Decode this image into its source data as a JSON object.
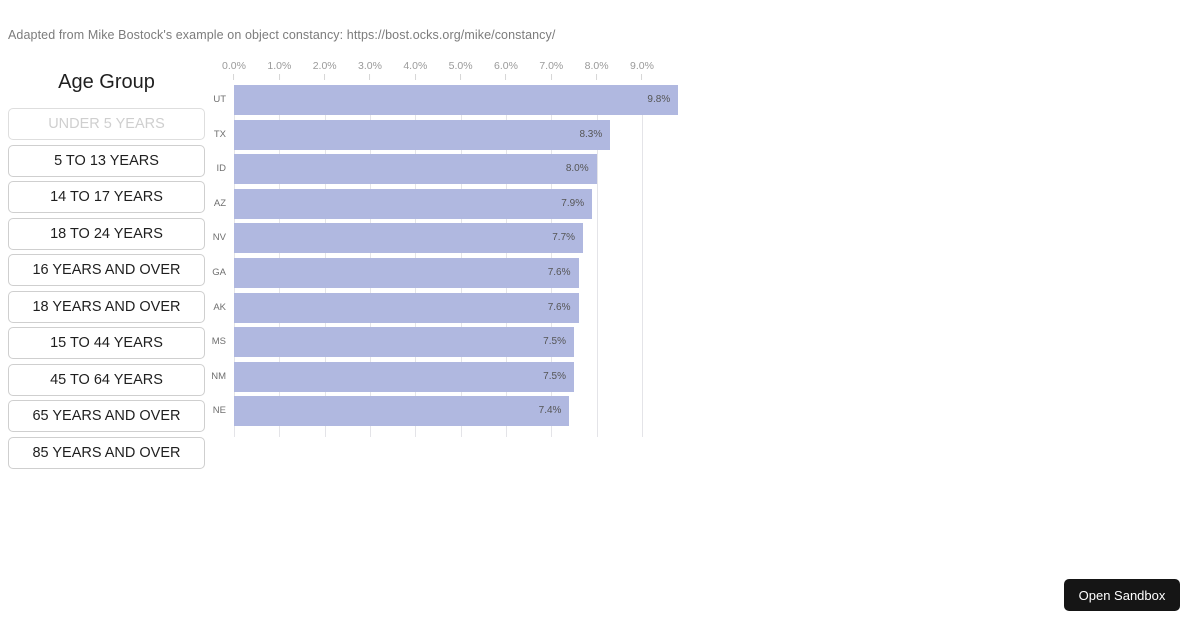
{
  "credit": "Adapted from Mike Bostock's example on object constancy: https://bost.ocks.org/mike/constancy/",
  "sidebar": {
    "title": "Age Group",
    "items": [
      {
        "label": "UNDER 5 YEARS",
        "disabled": true
      },
      {
        "label": "5 TO 13 YEARS",
        "disabled": false
      },
      {
        "label": "14 TO 17 YEARS",
        "disabled": false
      },
      {
        "label": "18 TO 24 YEARS",
        "disabled": false
      },
      {
        "label": "16 YEARS AND OVER",
        "disabled": false
      },
      {
        "label": "18 YEARS AND OVER",
        "disabled": false
      },
      {
        "label": "15 TO 44 YEARS",
        "disabled": false
      },
      {
        "label": "45 TO 64 YEARS",
        "disabled": false
      },
      {
        "label": "65 YEARS AND OVER",
        "disabled": false
      },
      {
        "label": "85 YEARS AND OVER",
        "disabled": false
      }
    ]
  },
  "footer": {
    "open_sandbox_label": "Open Sandbox"
  },
  "colors": {
    "bar_fill": "#b0b8e0",
    "gridline": "#e4e4e8",
    "tick_label": "#9a9a9a",
    "bar_label": "#6f6f6f",
    "value_label": "#555555",
    "sandbox_button_bg": "#151515"
  },
  "chart_data": {
    "type": "bar",
    "orientation": "horizontal",
    "title": "",
    "subtitle": "",
    "xlabel": "",
    "ylabel": "",
    "categories": [
      "UT",
      "TX",
      "ID",
      "AZ",
      "NV",
      "GA",
      "AK",
      "MS",
      "NM",
      "NE"
    ],
    "values": [
      9.8,
      8.3,
      8.0,
      7.9,
      7.7,
      7.6,
      7.6,
      7.5,
      7.5,
      7.4
    ],
    "value_labels": [
      "9.8%",
      "8.3%",
      "8.0%",
      "7.9%",
      "7.7%",
      "7.6%",
      "7.6%",
      "7.5%",
      "7.5%",
      "7.4%"
    ],
    "xlim": [
      0,
      9.8
    ],
    "xticks": [
      0,
      1,
      2,
      3,
      4,
      5,
      6,
      7,
      8,
      9
    ],
    "xtick_labels": [
      "0.0%",
      "1.0%",
      "2.0%",
      "3.0%",
      "4.0%",
      "5.0%",
      "6.0%",
      "7.0%",
      "8.0%",
      "9.0%"
    ],
    "grid": true,
    "legend": false,
    "sorted": "descending"
  }
}
